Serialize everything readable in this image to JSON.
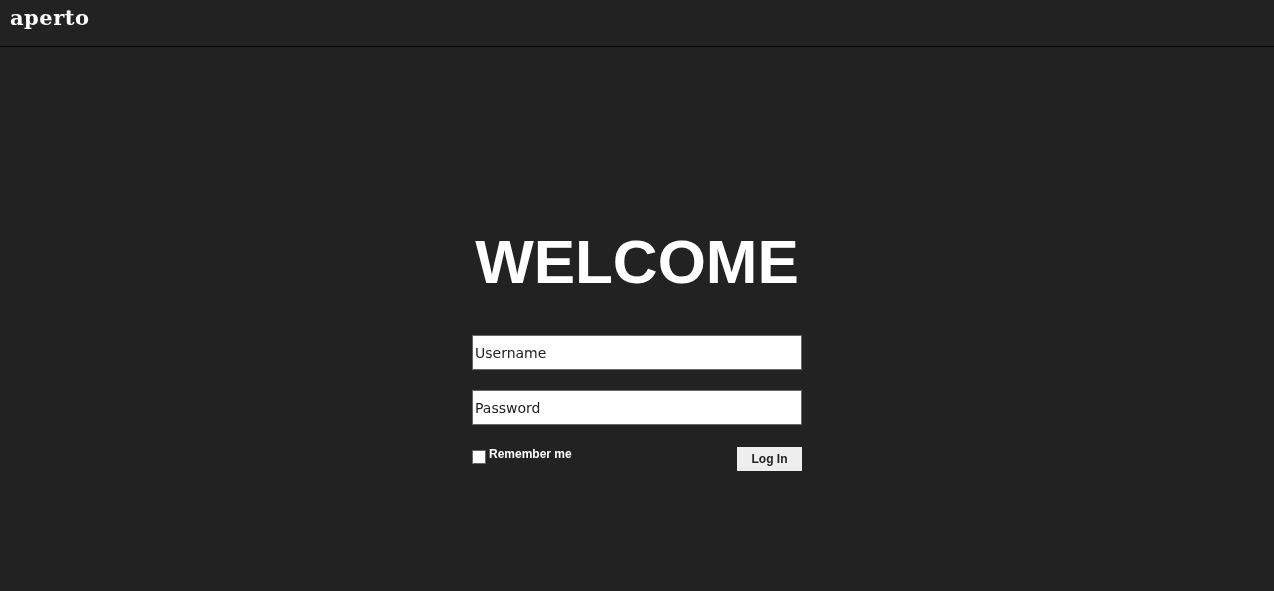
{
  "header": {
    "logo": "aperto"
  },
  "heading": "WELCOME",
  "form": {
    "username": {
      "placeholder": "Username"
    },
    "password": {
      "placeholder": "Password"
    },
    "remember": {
      "label": "Remember me",
      "checked": false
    },
    "submit": "Log In"
  }
}
